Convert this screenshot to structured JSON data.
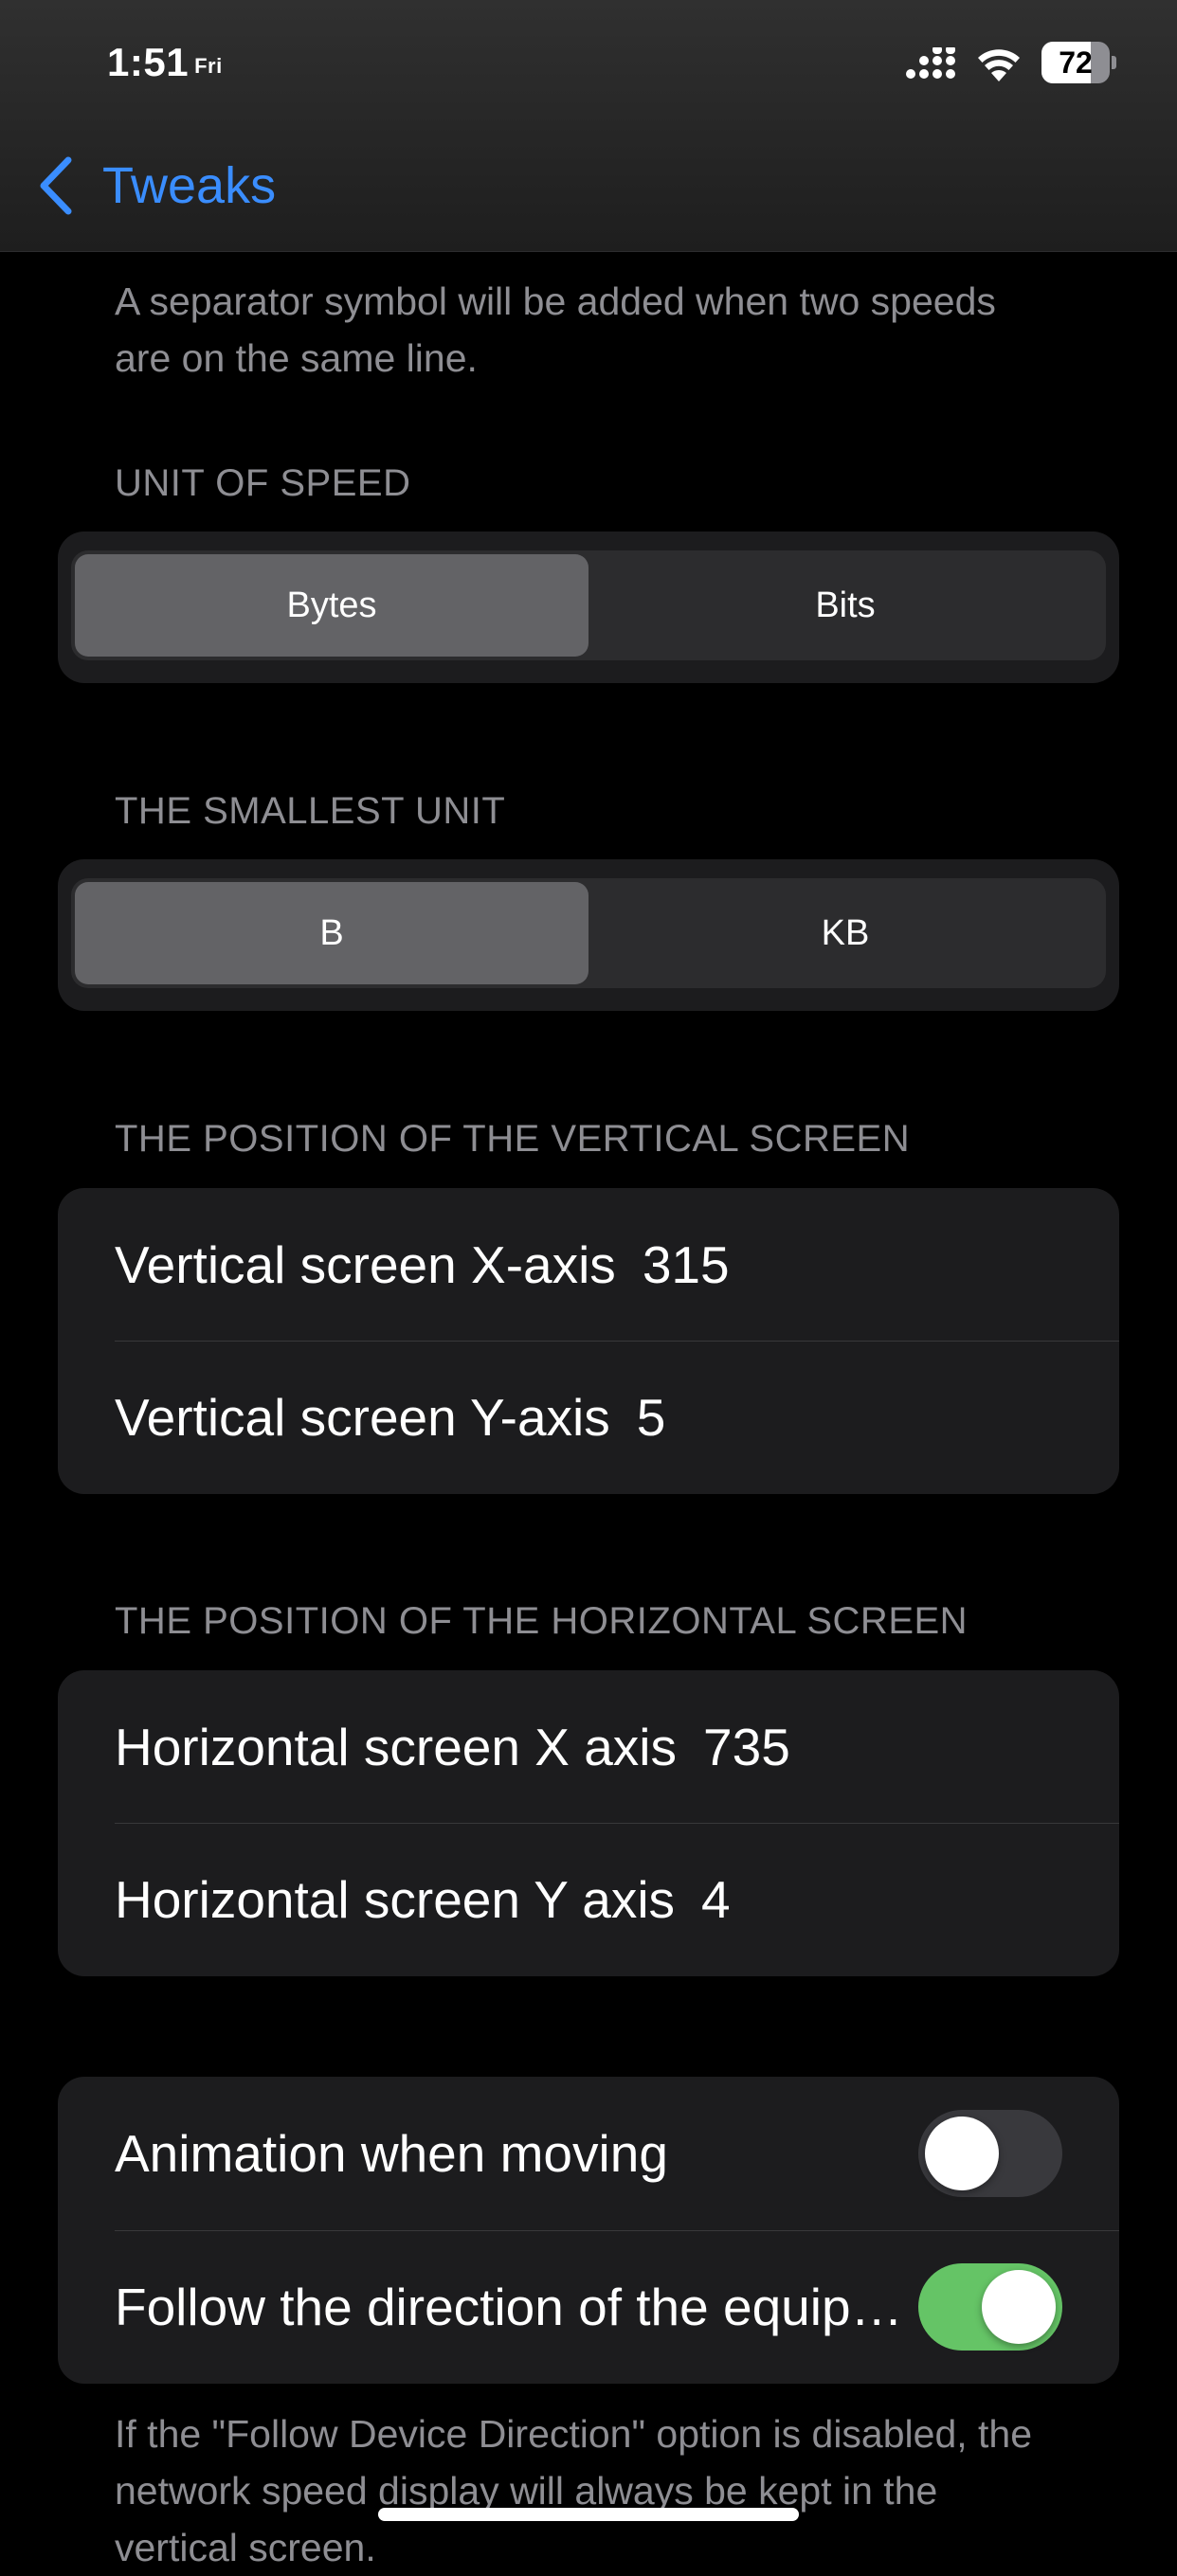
{
  "status_bar": {
    "time": "1:51",
    "day": "Fri",
    "battery_percent": "72",
    "battery_level": 0.72
  },
  "nav": {
    "back_label": "Tweaks"
  },
  "separator_note": "A separator symbol will be added when two speeds are on the same line.",
  "unit_of_speed": {
    "header": "UNIT OF SPEED",
    "options": [
      "Bytes",
      "Bits"
    ],
    "selected": "Bytes"
  },
  "smallest_unit": {
    "header": "THE SMALLEST UNIT",
    "options": [
      "B",
      "KB"
    ],
    "selected": "B"
  },
  "vertical_position": {
    "header": "THE POSITION OF THE VERTICAL SCREEN",
    "rows": [
      {
        "label": "Vertical screen X-axis",
        "value": "315"
      },
      {
        "label": "Vertical screen Y-axis",
        "value": "5"
      }
    ]
  },
  "horizontal_position": {
    "header": "THE POSITION OF THE HORIZONTAL SCREEN",
    "rows": [
      {
        "label": "Horizontal screen X axis",
        "value": "735"
      },
      {
        "label": "Horizontal screen Y axis",
        "value": "4"
      }
    ]
  },
  "toggles": [
    {
      "label": "Animation when moving",
      "on": false
    },
    {
      "label": "Follow the direction of the equipment",
      "on": true
    }
  ],
  "follow_note": "If the \"Follow Device Direction\" option is disabled, the network speed display will always be kept in the vertical screen.",
  "colors": {
    "accent": "#3a8dfe",
    "toggle_on": "#65c466",
    "toggle_off": "#39393d",
    "group_bg": "#1c1c1e",
    "segment_selected": "#636366"
  },
  "icons": [
    "cellular-signal-icon",
    "wifi-icon",
    "battery-icon",
    "chevron-left-icon"
  ]
}
